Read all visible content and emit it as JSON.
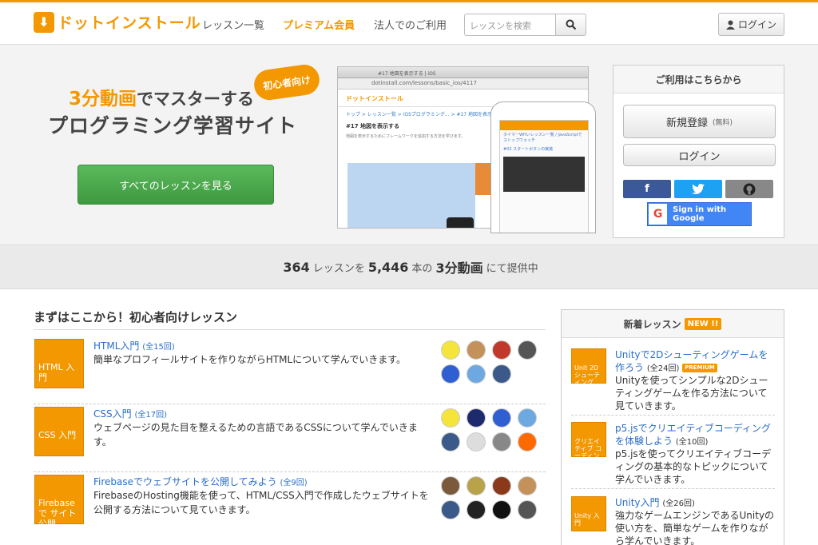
{
  "header": {
    "logo_text": "ドットインストール",
    "logo_badge": "⬇",
    "nav": [
      "レッスン一覧",
      "プレミアム会員",
      "法人でのご利用"
    ],
    "search_placeholder": "レッスンを検索",
    "login_label": "ログイン"
  },
  "hero": {
    "tagline_highlight": "3分動画",
    "tagline_rest": "でマスターする",
    "tagline2": "プログラミング学習サイト",
    "bubble": "初心者向け",
    "all_lessons_button": "すべてのレッスンを見る",
    "browser": {
      "tab": "#17 地図を表示する | iOS",
      "url": "dotinstall.com/lessons/basic_ios/4117",
      "logo": "ドットインストール",
      "crumb": "トップ > レッスン一覧 > iOSプログラミング... > #17 地図を表示",
      "heading": "#17 地図を表示する",
      "subtext": "地図を表示するためにフレームワークを追加する方法を学びます。"
    },
    "phone": {
      "line1": "タイマーWHいレッスン一覧 / JavaScriptでストップウォッチ",
      "line2": "#02 スタートボタンの実装"
    }
  },
  "signup": {
    "title": "ご利用はこちらから",
    "register_label": "新規登録",
    "register_note": "(無料)",
    "login_label": "ログイン",
    "facebook": "f",
    "twitter": "t",
    "github": "gh",
    "google_label": "Sign in with Google",
    "google_icon": "G"
  },
  "stats": {
    "lessons": "364",
    "lessons_unit": "レッスンを",
    "videos": "5,446",
    "videos_unit": "本の",
    "format": "3分動画",
    "suffix": "にて提供中"
  },
  "beginner": {
    "title": "まずはここから！初心者向けレッスン",
    "lessons": [
      {
        "thumb": "HTML 入門",
        "title": "HTML入門",
        "count": "(全15回)",
        "desc": "簡単なプロフィールサイトを作りながらHTMLについて学んでいきます。",
        "avatars": [
          "#f5e43a",
          "#c4915a",
          "#c0392b",
          "#555555",
          "#2f5fd0",
          "#6da8e0",
          "#3b5a8a"
        ]
      },
      {
        "thumb": "CSS 入門",
        "title": "CSS入門",
        "count": "(全17回)",
        "desc": "ウェブページの見た目を整えるための言語であるCSSについて学んでいきます。",
        "avatars": [
          "#f5e43a",
          "#1e2a6e",
          "#2f5fd0",
          "#6da8e0",
          "#3b5a8a",
          "#dddddd",
          "#888888",
          "#ff6a00"
        ]
      },
      {
        "thumb": "Firebaseで サイト公開",
        "title": "Firebaseでウェブサイトを公開してみよう",
        "count": "(全9回)",
        "desc": "FirebaseのHosting機能を使って、HTML/CSS入門で作成したウェブサイトを公開する方法について見ていきます。",
        "avatars": [
          "#7a5a3a",
          "#b8a24a",
          "#8a3a1a",
          "#c4915a",
          "#3b5a8a",
          "#222222",
          "#111111",
          "#555555"
        ]
      }
    ]
  },
  "new_lessons": {
    "title": "新着レッスン",
    "badge": "NEW !!",
    "items": [
      {
        "thumb": "Unit 2Dシューティング",
        "title": "Unityで2Dシューティングゲームを作ろう",
        "count": "(全24回)",
        "premium": "PREMIUM",
        "desc": "Unityを使ってシンプルな2Dシューティングゲームを作る方法について見ていきます。"
      },
      {
        "thumb": "クリエイティブ コーディング",
        "title": "p5.jsでクリエイティブコーディングを体験しよう",
        "count": "(全10回)",
        "desc": "p5.jsを使ってクリエイティブコーディングの基本的なトピックについて学んでいきます。"
      },
      {
        "thumb": "Unity 入門",
        "title": "Unity入門",
        "count": "(全26回)",
        "desc": "強力なゲームエンジンであるUnityの使い方を、簡単なゲームを作りながら学んでいきます。"
      }
    ]
  },
  "colors": {
    "brand": "#f39800",
    "link": "#2a6ec8",
    "green_button": "#4caf50"
  }
}
